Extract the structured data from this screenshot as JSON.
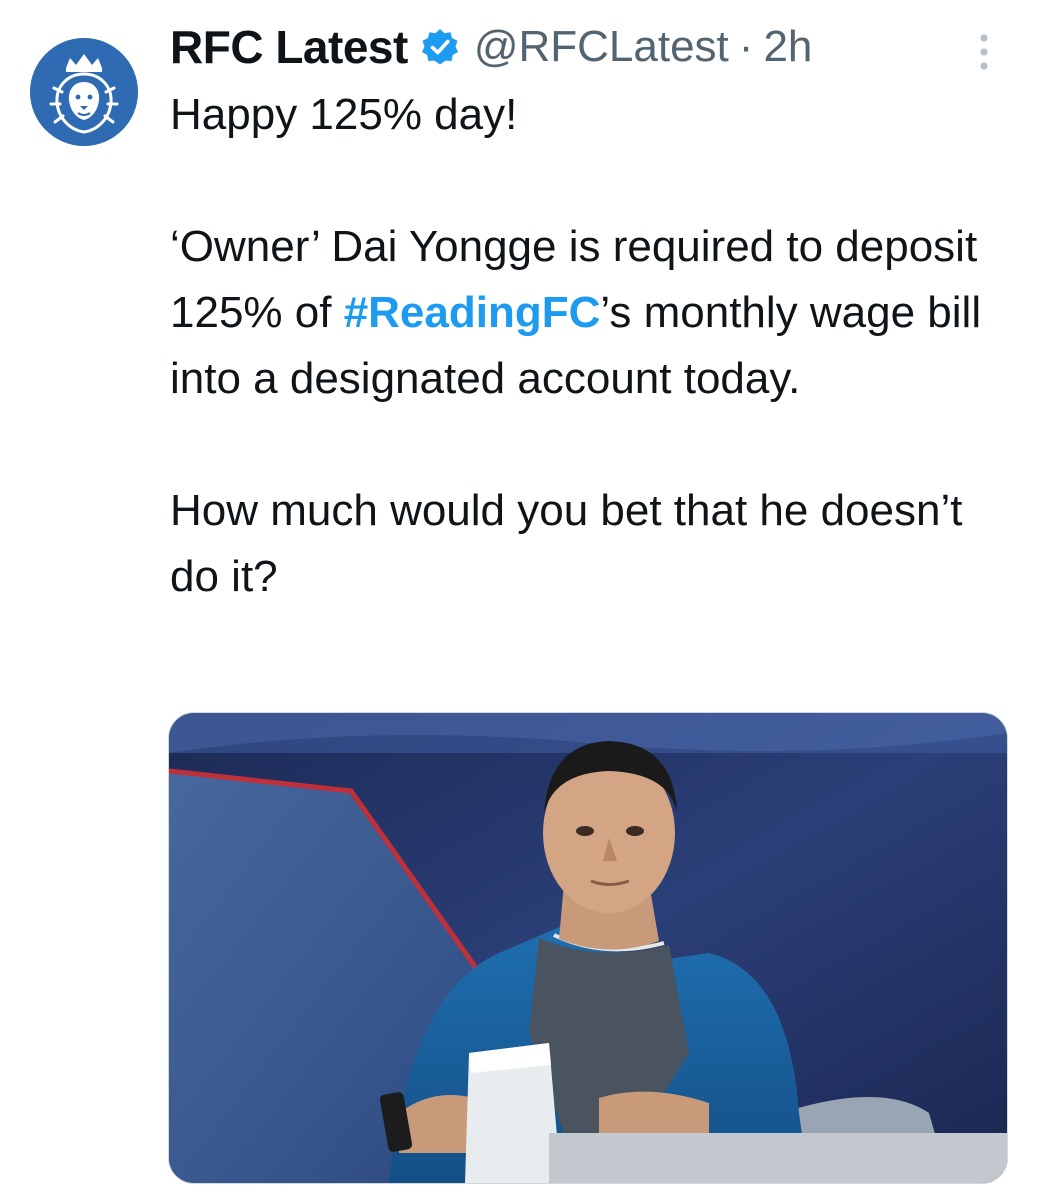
{
  "author": {
    "display_name": "RFC Latest",
    "handle": "@RFCLatest",
    "separator": "·",
    "time": "2h"
  },
  "tweet": {
    "line_1": "Happy 125% day!",
    "para_2_before": "‘Owner’ Dai Yongge is required to deposit 125% of ",
    "hashtag": "#ReadingFC",
    "para_2_after": "’s monthly wage bill into a designated account today.",
    "para_3": "How much would you bet that he doesn’t do it?"
  },
  "icons": {
    "avatar": "lion-crown-logo-icon",
    "verified": "verified-badge-icon",
    "more": "more-vertical-icon"
  },
  "colors": {
    "brand_blue": "#2f6bb3",
    "verified_blue": "#1d9bf0",
    "hashtag_blue": "#1d9bf0",
    "secondary_text": "#536471"
  }
}
